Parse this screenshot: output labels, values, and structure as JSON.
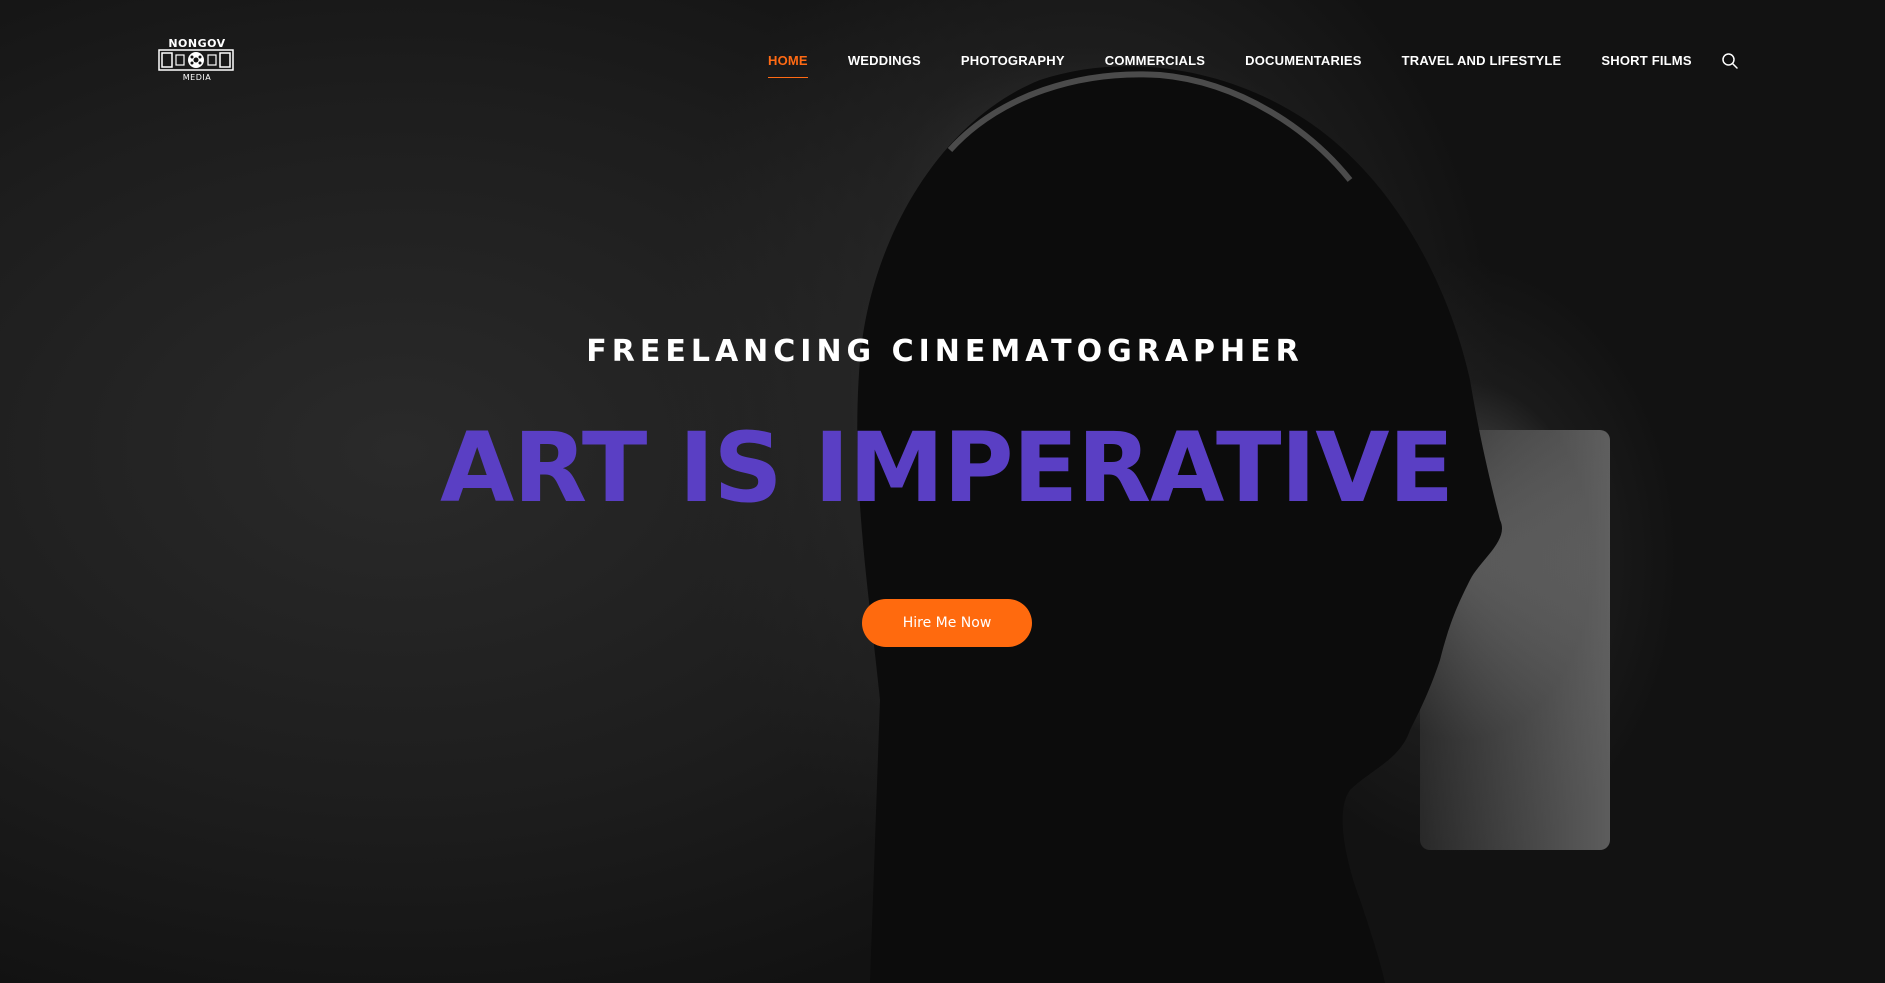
{
  "logo": {
    "top_text": "NONGOV",
    "bottom_text": "MEDIA"
  },
  "nav": {
    "items": [
      {
        "label": "HOME",
        "active": true
      },
      {
        "label": "WEDDINGS",
        "active": false
      },
      {
        "label": "PHOTOGRAPHY",
        "active": false
      },
      {
        "label": "COMMERCIALS",
        "active": false
      },
      {
        "label": "DOCUMENTARIES",
        "active": false
      },
      {
        "label": "TRAVEL AND LIFESTYLE",
        "active": false
      },
      {
        "label": "SHORT FILMS",
        "active": false
      }
    ],
    "search_icon": "search-icon"
  },
  "hero": {
    "subtitle": "FREELANCING CINEMATOGRAPHER",
    "headline": "ART IS IMPERATIVE",
    "cta_label": "Hire Me Now"
  },
  "colors": {
    "accent": "#ff6a14",
    "headline": "#5a3fc4",
    "text": "#ffffff",
    "background": "#161616"
  }
}
